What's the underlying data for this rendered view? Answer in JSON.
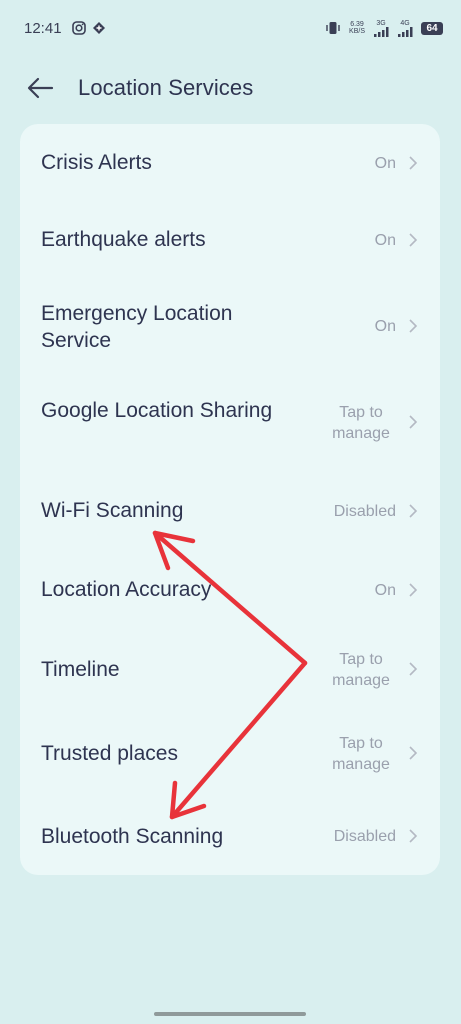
{
  "status_bar": {
    "time": "12:41",
    "net_speed_value": "6.39",
    "net_speed_unit": "KB/S",
    "network_1": "3G",
    "network_2": "4G",
    "battery": "64"
  },
  "header": {
    "title": "Location Services",
    "back_icon": "arrow-left-icon"
  },
  "settings": [
    {
      "label": "Crisis Alerts",
      "value": "On"
    },
    {
      "label": "Earthquake alerts",
      "value": "On"
    },
    {
      "label": "Emergency Location Service",
      "value": "On"
    },
    {
      "label": "Google Location Sharing",
      "value": "Tap to manage"
    },
    {
      "label": "Wi-Fi Scanning",
      "value": "Disabled"
    },
    {
      "label": "Location Accuracy",
      "value": "On"
    },
    {
      "label": "Timeline",
      "value": "Tap to manage"
    },
    {
      "label": "Trusted places",
      "value": "Tap to manage"
    },
    {
      "label": "Bluetooth Scanning",
      "value": "Disabled"
    }
  ],
  "colors": {
    "background": "#d9efef",
    "card": "#ebf8f8",
    "text": "#2e3450",
    "secondary_text": "#9aa0ad",
    "annotation_arrow": "#e8333a"
  }
}
